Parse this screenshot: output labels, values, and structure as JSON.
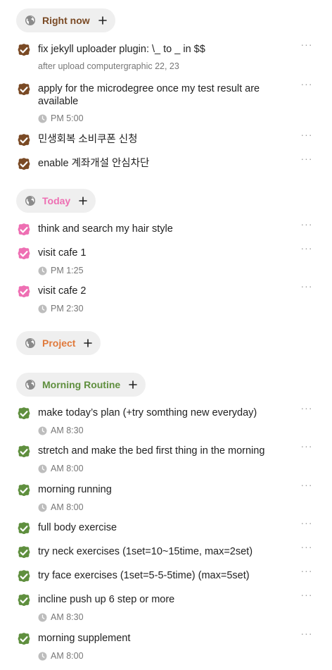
{
  "colors": {
    "right_now": "#7a4a25",
    "today": "#ee6fb3",
    "project": "#e07a3c",
    "morning": "#5f8f3e",
    "pill_bg": "#efefef",
    "icon_gray": "#8a8a8a"
  },
  "icons": {
    "category": "globe-icon",
    "add": "plus-icon",
    "time": "clock-icon",
    "more": "more-horizontal-icon",
    "check": "checkbox-checked-icon"
  },
  "more_glyph": "···",
  "categories": [
    {
      "title": "Right now",
      "todos": [
        {
          "title": "fix jekyll uploader plugin: \\_ to _ in $$",
          "note": "after upload computergraphic 22, 23"
        },
        {
          "title": "apply for the microdegree once my test result are available",
          "time": "PM 5:00"
        },
        {
          "title": "민생회복 소비쿠폰 신청"
        },
        {
          "title": "enable 계좌개설 안심차단"
        }
      ]
    },
    {
      "title": "Today",
      "todos": [
        {
          "title": "think and search my hair style"
        },
        {
          "title": "visit cafe 1",
          "time": "PM 1:25"
        },
        {
          "title": "visit cafe 2",
          "time": "PM 2:30"
        }
      ]
    },
    {
      "title": "Project",
      "todos": []
    },
    {
      "title": "Morning Routine",
      "todos": [
        {
          "title": "make today’s plan (+try somthing new everyday)",
          "time": "AM 8:30"
        },
        {
          "title": "stretch and make the bed first thing in the morning",
          "time": "AM 8:00"
        },
        {
          "title": "morning running",
          "time": "AM 8:00"
        },
        {
          "title": "full body exercise"
        },
        {
          "title": "try neck exercises (1set=10~15time, max=2set)"
        },
        {
          "title": "try face exercises (1set=5-5-5time) (max=5set)"
        },
        {
          "title": "incline push up 6 step or more",
          "time": "AM 8:30"
        },
        {
          "title": "morning supplement",
          "time": "AM 8:00"
        }
      ]
    }
  ]
}
